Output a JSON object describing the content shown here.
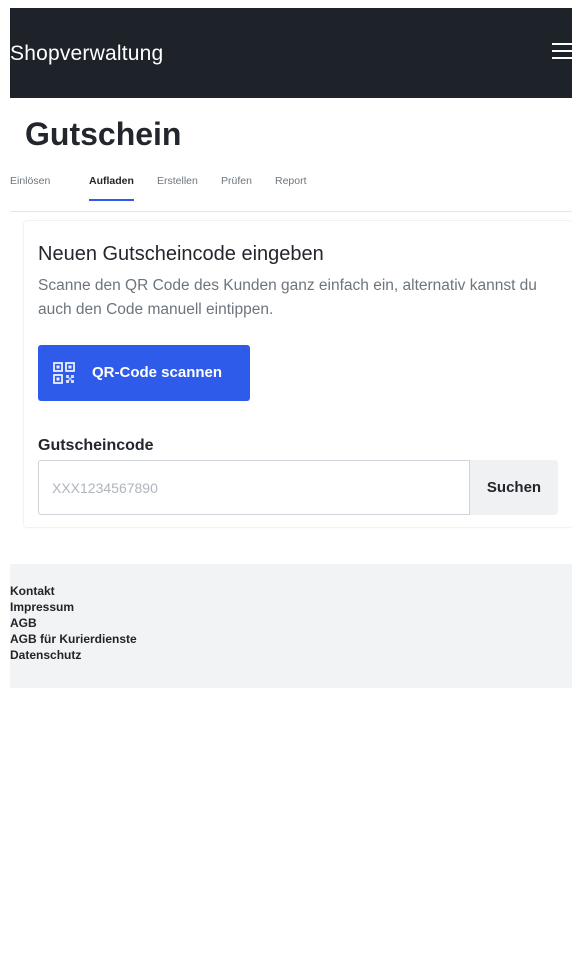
{
  "header": {
    "brand": "Shopverwaltung",
    "menu_icon": "hamburger-menu-icon"
  },
  "page": {
    "title": "Gutschein"
  },
  "tabs": [
    {
      "label": "Einlösen",
      "active": false
    },
    {
      "label": "Aufladen",
      "active": true
    },
    {
      "label": "Erstellen",
      "active": false
    },
    {
      "label": "Prüfen",
      "active": false
    },
    {
      "label": "Report",
      "active": false
    }
  ],
  "card": {
    "title": "Neuen Gutscheincode eingeben",
    "description": "Scanne den QR Code des Kunden ganz einfach ein, alternativ kannst du auch den Code manuell eintippen.",
    "qr_button_label": "QR-Code scannen",
    "qr_icon": "qr-code-icon",
    "field_label": "Gutscheincode",
    "input_placeholder": "XXX1234567890",
    "input_value": "",
    "search_label": "Suchen"
  },
  "footer": {
    "links": [
      "Kontakt",
      "Impressum",
      "AGB",
      "AGB für Kurierdienste",
      "Datenschutz"
    ]
  },
  "colors": {
    "navbar": "#1e2229",
    "accent": "#2f5bea",
    "footer": "#f2f3f4"
  }
}
